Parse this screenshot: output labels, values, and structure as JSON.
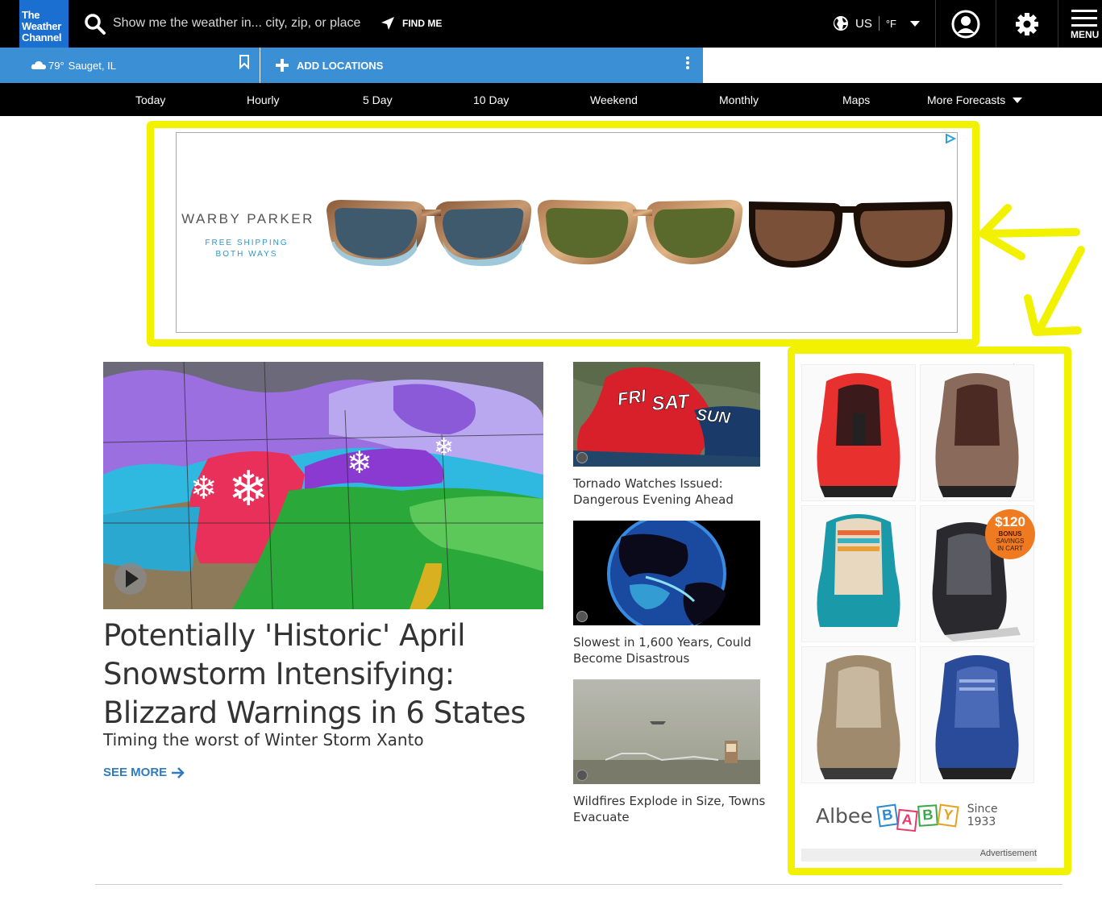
{
  "header": {
    "logo_lines": [
      "The",
      "Weather",
      "Channel"
    ],
    "search_placeholder": "Show me the weather in... city, zip, or place",
    "find_me": "FIND ME",
    "region": "US",
    "units": "°F",
    "menu_label": "MENU"
  },
  "location_bar": {
    "current_temp": "79°",
    "current_place": "Sauget, IL",
    "add_locations": "ADD LOCATIONS"
  },
  "forecast_nav": [
    "Today",
    "Hourly",
    "5 Day",
    "10 Day",
    "Weekend",
    "Monthly",
    "Maps",
    "More Forecasts"
  ],
  "top_ad": {
    "brand": "WARBY PARKER",
    "tagline": "FREE SHIPPING BOTH WAYS"
  },
  "main_story": {
    "headline": "Potentially 'Historic' April Snowstorm Intensifying: Blizzard Warnings in 6 States",
    "subhead": "Timing the worst of Winter Storm Xanto",
    "see_more": "SEE MORE"
  },
  "side_stories": [
    {
      "caption": "Tornado Watches Issued: Dangerous Evening Ahead",
      "thumb_text": [
        "FRI",
        "SAT",
        "SUN"
      ]
    },
    {
      "caption": "Slowest in 1,600 Years, Could Become Disastrous"
    },
    {
      "caption": "Wildfires Explode in Size, Towns Evacuate"
    }
  ],
  "side_ad": {
    "badge_price": "$120",
    "badge_line1": "BONUS",
    "badge_line2": "SAVINGS",
    "badge_line3": "IN CART",
    "brand_prefix": "Albee",
    "brand_blocks": [
      "B",
      "A",
      "B",
      "Y"
    ],
    "since": "Since 1933",
    "advertisement_label": "Advertisement"
  },
  "colors": {
    "brand_blue": "#1b6fd0",
    "location_bar_blue": "#3b8fd4",
    "link_blue": "#2e7bbf",
    "annotation_yellow": "#f2f200"
  }
}
